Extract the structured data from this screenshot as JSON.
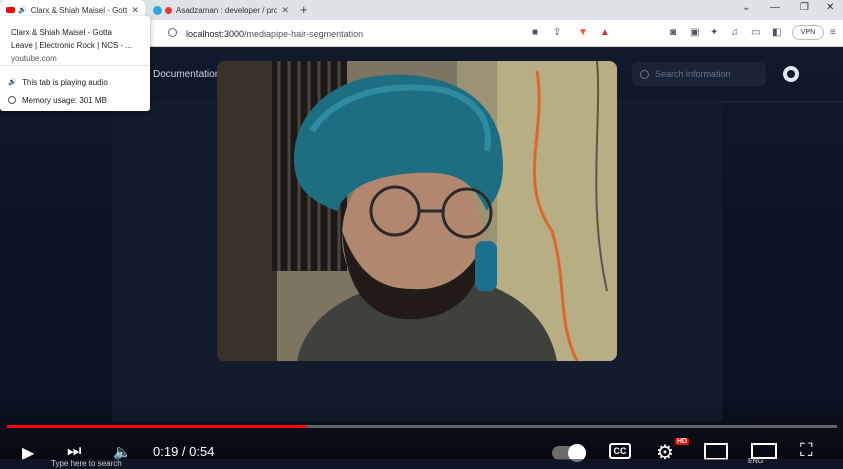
{
  "browser": {
    "tabs": [
      {
        "title": "Clarx & Shiah Maisel - Gotta",
        "favicon": "youtube-icon",
        "audio": true
      },
      {
        "title": "Asadzaman : developer / pro",
        "favicon": "app-icon"
      }
    ],
    "url_host": "localhost:3000",
    "url_path": "/mediapipe-hair-segmentation",
    "vpn_label": "VPN"
  },
  "popup": {
    "title_line1": "Clarx & Shiah Maisel - Gotta",
    "title_line2": "Leave | Electronic Rock | NCS - ...",
    "domain": "youtube.com",
    "audio_status": "This tab is playing audio",
    "memory_usage": "Memory usage: 301 MB"
  },
  "app": {
    "nav_documentation": "Documentation",
    "search_placeholder": "Search information"
  },
  "player": {
    "time": "0:19 / 0:54",
    "progress": 0.36,
    "hd_badge": "HD",
    "colors": {
      "progress": "#ff0000"
    }
  },
  "taskbar": {
    "search_placeholder": "Type here to search",
    "lang": "ENG"
  }
}
